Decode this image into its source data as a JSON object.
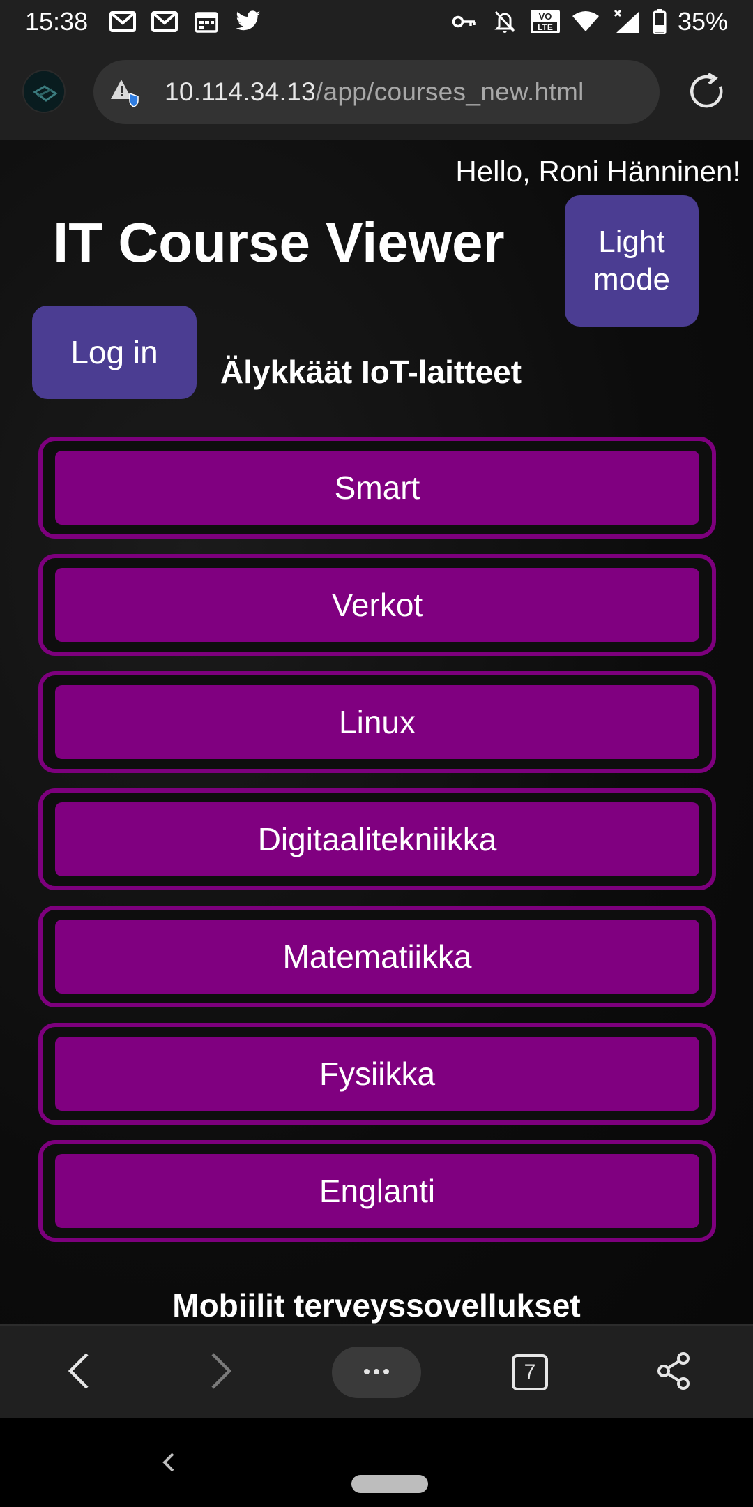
{
  "status_bar": {
    "time": "15:38",
    "left_icons": [
      "gmail-icon",
      "gmail-icon",
      "calendar-icon",
      "twitter-icon"
    ],
    "right_icons": [
      "vpn-key-icon",
      "bell-off-icon",
      "volte-icon",
      "wifi-icon",
      "signal-icon",
      "battery-icon"
    ],
    "volte_label": "VO\nLTE",
    "battery": "35%"
  },
  "browser": {
    "url_host": "10.114.34.13",
    "url_path": "/app/courses_new.html",
    "tab_count": "7"
  },
  "page": {
    "greeting": "Hello, Roni Hänninen!",
    "title": "IT Course Viewer",
    "light_mode_label": "Light\nmode",
    "login_label": "Log in",
    "section_title": "Älykkäät IoT-laitteet",
    "courses": [
      {
        "label": "Smart"
      },
      {
        "label": "Verkot"
      },
      {
        "label": "Linux"
      },
      {
        "label": "Digitaalitekniikka"
      },
      {
        "label": "Matematiikka"
      },
      {
        "label": "Fysiikka"
      },
      {
        "label": "Englanti"
      }
    ],
    "next_section_title": "Mobiilit terveyssovellukset"
  },
  "colors": {
    "course_purple": "#800080",
    "course_border": "#7d007d",
    "accent_button": "#4b3d92",
    "background": "#0c0c0c"
  }
}
